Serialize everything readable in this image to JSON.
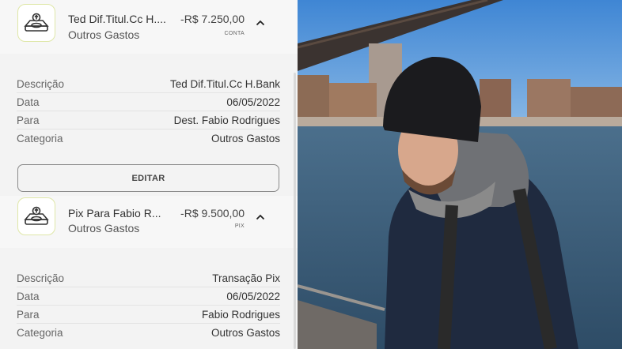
{
  "transactions": [
    {
      "title": "Ted Dif.Titul.Cc H.Bank",
      "title_display": "Ted Dif.Titul.Cc H....",
      "category": "Outros Gastos",
      "amount": "-R$  7.250,00",
      "type": "CONTA",
      "icon": "money-transfer-icon",
      "details": [
        {
          "label": "Descrição",
          "value": "Ted Dif.Titul.Cc H.Bank"
        },
        {
          "label": "Data",
          "value": "06/05/2022"
        },
        {
          "label": "Para",
          "value": "Dest. Fabio Rodrigues"
        },
        {
          "label": "Categoria",
          "value": "Outros Gastos"
        }
      ],
      "edit_label": "EDITAR"
    },
    {
      "title": "Pix Para Fabio Rodrigues",
      "title_display": "Pix Para Fabio R...",
      "category": "Outros Gastos",
      "amount": "-R$  9.500,00",
      "type": "PIX",
      "icon": "money-transfer-icon",
      "details": [
        {
          "label": "Descrição",
          "value": "Transação Pix"
        },
        {
          "label": "Data",
          "value": "06/05/2022"
        },
        {
          "label": "Para",
          "value": "Fabio Rodrigues"
        },
        {
          "label": "Categoria",
          "value": "Outros Gastos"
        }
      ]
    }
  ],
  "colors": {
    "icon_border": "#dfe7a8",
    "panel_bg": "#f6f6f6",
    "sky": "#4a90d9",
    "water": "#3a5d7a"
  }
}
